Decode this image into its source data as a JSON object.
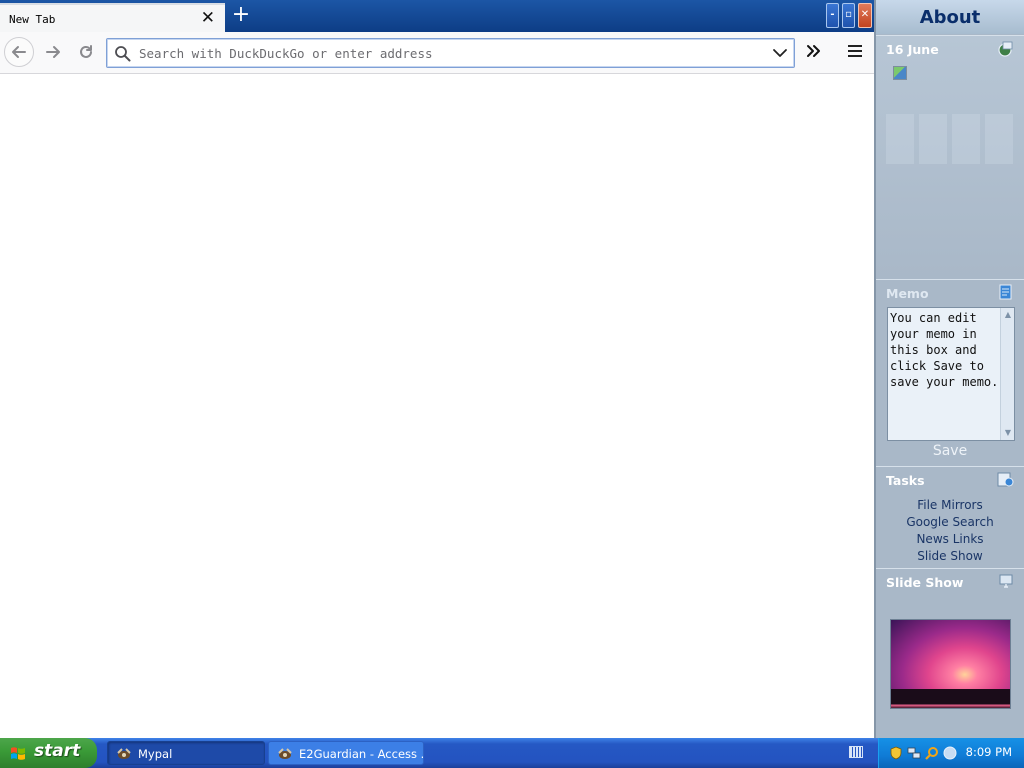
{
  "browser": {
    "tab": {
      "title": "New Tab"
    },
    "window_controls": {
      "minimize": "-",
      "restore": "▫",
      "close": "✕"
    },
    "urlbar": {
      "placeholder": "Search with DuckDuckGo or enter address",
      "value": ""
    },
    "icons": {
      "back": "back-arrow-icon",
      "forward": "forward-arrow-icon",
      "reload": "reload-icon",
      "search": "search-icon",
      "dropdown": "chevron-down-icon",
      "overflow": "double-chevron-icon",
      "menu": "hamburger-menu-icon"
    }
  },
  "sidebar": {
    "title": "About",
    "calendar": {
      "date": "16 June"
    },
    "memo": {
      "heading": "Memo",
      "text": "You can edit your memo in this box and click Save to save your memo.",
      "save_label": "Save"
    },
    "tasks": {
      "heading": "Tasks",
      "items": [
        "File Mirrors",
        "Google Search",
        "News Links",
        "Slide Show"
      ]
    },
    "slideshow": {
      "heading": "Slide Show"
    }
  },
  "taskbar": {
    "start_label": "start",
    "buttons": [
      {
        "label": "Mypal",
        "active": true
      },
      {
        "label": "E2Guardian - Access ...",
        "active": false
      }
    ],
    "clock": "8:09 PM"
  },
  "colors": {
    "tabstrip": "#0d3d86",
    "taskbar": "#2453c0",
    "start": "#3a9a37",
    "sidebar": "#a9b8c8",
    "about_title": "#0a2e6b"
  }
}
